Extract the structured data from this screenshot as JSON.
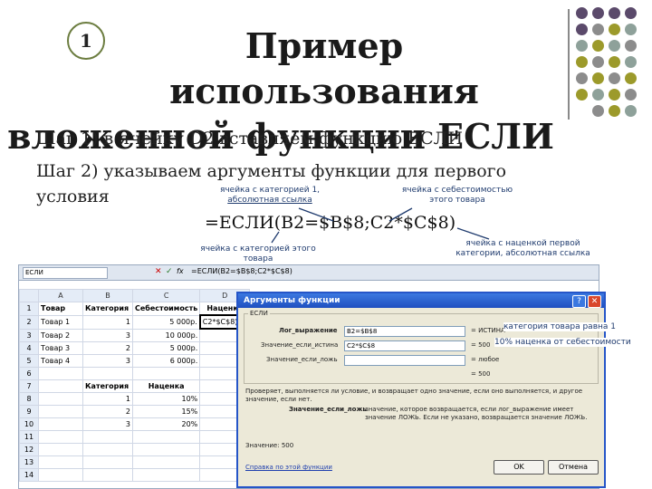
{
  "slide": {
    "badge": "1",
    "title_line1": "Пример использования",
    "title_line2": "вложенной функции ЕСЛИ",
    "step1": "Шаг 1) в ячейку D2 вставляем функцию ЕСЛИ",
    "step2_line1": "Шаг 2) указываем аргументы функции для первого",
    "step2_line2": "условия",
    "formula": "=ЕСЛИ(B2=$B$8;C2*$C$8)",
    "notes": {
      "n1_line1": "ячейка с категорией 1,",
      "n1_line2": "абсолютная ссылка",
      "n2_line1": "ячейка с себестоимостью",
      "n2_line2": "этого товара",
      "n3_line1": "ячейка с категорией этого",
      "n3_line2": "товара",
      "n4_line1": "ячейка с наценкой первой",
      "n4_line2": "категории, абсолютная ссылка"
    },
    "colors": {
      "olive": "#9c9a2b",
      "gray": "#8c8c8c",
      "teal_gray": "#8ea19a",
      "purple": "#5b4a6b"
    }
  },
  "excel": {
    "cell_ref": "ЕСЛИ",
    "formula_bar": "=ЕСЛИ(B2=$B$8;C2*$C$8)",
    "col_headers": [
      "A",
      "B",
      "C",
      "D"
    ],
    "rows": [
      {
        "n": "1",
        "cells": [
          "Товар",
          "Категория",
          "Себестоимость",
          "Наценка"
        ]
      },
      {
        "n": "2",
        "cells": [
          "Товар 1",
          "1",
          "5 000р.",
          "C2*$C$8)"
        ]
      },
      {
        "n": "3",
        "cells": [
          "Товар 2",
          "3",
          "10 000р.",
          ""
        ]
      },
      {
        "n": "4",
        "cells": [
          "Товар 3",
          "2",
          "5 000р.",
          ""
        ]
      },
      {
        "n": "5",
        "cells": [
          "Товар 4",
          "3",
          "6 000р.",
          ""
        ]
      },
      {
        "n": "6",
        "cells": [
          "",
          "",
          "",
          ""
        ]
      },
      {
        "n": "7",
        "cells": [
          "",
          "Категория",
          "Наценка",
          ""
        ]
      },
      {
        "n": "8",
        "cells": [
          "",
          "1",
          "10%",
          ""
        ]
      },
      {
        "n": "9",
        "cells": [
          "",
          "2",
          "15%",
          ""
        ]
      },
      {
        "n": "10",
        "cells": [
          "",
          "3",
          "20%",
          ""
        ]
      },
      {
        "n": "11",
        "cells": [
          "",
          "",
          "",
          ""
        ]
      },
      {
        "n": "12",
        "cells": [
          "",
          "",
          "",
          ""
        ]
      },
      {
        "n": "13",
        "cells": [
          "",
          "",
          "",
          ""
        ]
      },
      {
        "n": "14",
        "cells": [
          "",
          "",
          "",
          ""
        ]
      }
    ]
  },
  "dialog": {
    "title": "Аргументы функции",
    "group": "ЕСЛИ",
    "label1": "Лог_выражение",
    "value1": "B2=$B$8",
    "result1": "= ИСТИНА",
    "label2": "Значение_если_истина",
    "value2": "C2*$C$8",
    "result2": "= 500",
    "label3": "Значение_если_ложь",
    "value3": "",
    "result3": "= любое",
    "total": "= 500",
    "desc1": "Проверяет, выполняется ли условие, и возвращает одно значение, если оно выполняется, и другое значение, если нет.",
    "desc2_label": "Значение_если_ложь",
    "desc2": "значение, которое возвращается, если лог_выражение имеет значение ЛОЖЬ. Если не указано, возвращается значение ЛОЖЬ.",
    "value_label": "Значение: 500",
    "help_link": "Справка по этой функции",
    "ok": "OK",
    "cancel": "Отмена",
    "callout1": "категория товара равна 1",
    "callout2": "10% наценка от себестоимости"
  }
}
